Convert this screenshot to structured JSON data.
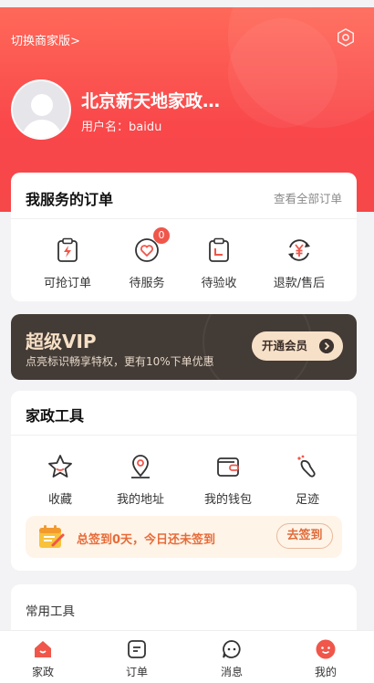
{
  "header": {
    "switch_label": "切换商家版>",
    "shop_name": "北京新天地家政…",
    "username": "用户名：baidu"
  },
  "orders": {
    "title": "我服务的订单",
    "view_all": "查看全部订单",
    "items": [
      {
        "label": "可抢订单",
        "icon": "lightning-clipboard-icon"
      },
      {
        "label": "待服务",
        "icon": "heart-service-icon",
        "badge": "0"
      },
      {
        "label": "待验收",
        "icon": "checklist-icon"
      },
      {
        "label": "退款/售后",
        "icon": "refund-yen-icon"
      }
    ]
  },
  "vip": {
    "title": "超级VIP",
    "subtitle": "点亮标识畅享特权，更有10%下单优惠",
    "button": "开通会员"
  },
  "tools": {
    "title": "家政工具",
    "items": [
      {
        "label": "收藏",
        "icon": "star-icon"
      },
      {
        "label": "我的地址",
        "icon": "location-pin-icon"
      },
      {
        "label": "我的钱包",
        "icon": "wallet-icon"
      },
      {
        "label": "足迹",
        "icon": "footprint-icon"
      }
    ],
    "checkin_text": "总签到0天，今日还未签到",
    "checkin_button": "去签到"
  },
  "common": {
    "title": "常用工具"
  },
  "tabbar": [
    {
      "label": "家政",
      "icon": "home-icon",
      "active": true
    },
    {
      "label": "订单",
      "icon": "order-icon"
    },
    {
      "label": "消息",
      "icon": "message-icon"
    },
    {
      "label": "我的",
      "icon": "profile-icon",
      "active": true
    }
  ],
  "colors": {
    "brand": "#f64749",
    "vip_bg": "#433b36",
    "vip_gold": "#f6e0c6",
    "checkin_orange": "#e86b38"
  }
}
